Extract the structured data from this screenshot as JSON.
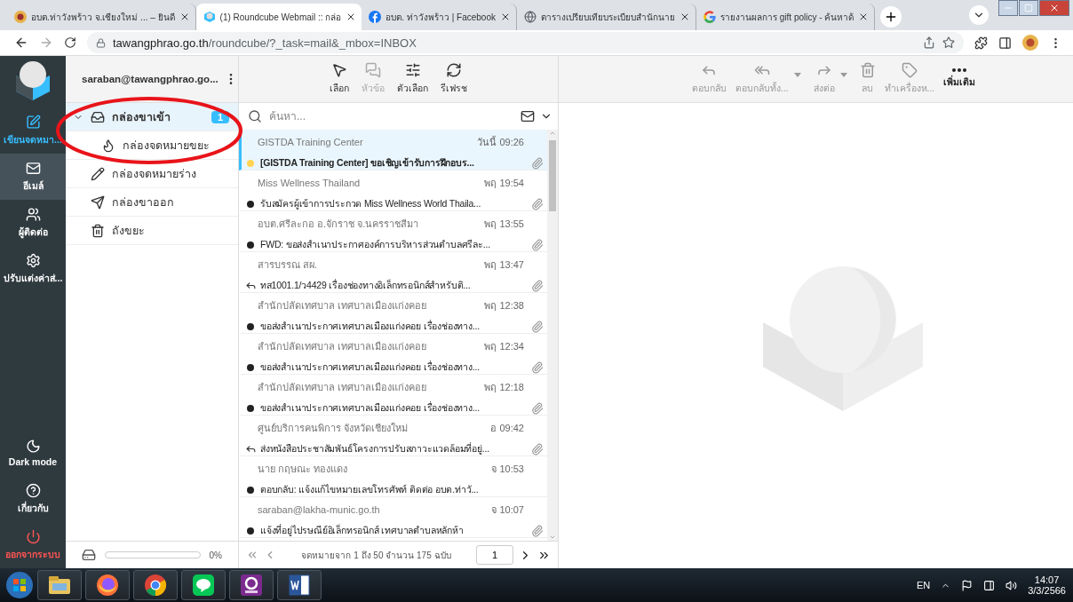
{
  "browser": {
    "tabs": [
      {
        "title": "อบต.ท่าวังพร้าว จ.เชียงใหม่ ... – ยินดี",
        "selected": false
      },
      {
        "title": "(1) Roundcube Webmail :: กล่อ",
        "selected": true
      },
      {
        "title": "อบต. ท่าวังพร้าว | Facebook",
        "selected": false
      },
      {
        "title": "ตารางเปรียบเทียบระเบียบสำนักนาย",
        "selected": false
      },
      {
        "title": "รายงานผลการ gift policy - ค้นหาด้",
        "selected": false
      }
    ],
    "url": {
      "host": "tawangphrao.go.th",
      "path": "/roundcube/?_task=mail&_mbox=INBOX"
    }
  },
  "nav": {
    "top": [
      {
        "kind": "compose",
        "label": "เขียนจดหมา...",
        "selected": false
      },
      {
        "kind": "mail",
        "label": "อีเมล์",
        "selected": true
      },
      {
        "kind": "contacts",
        "label": "ผู้ติดต่อ",
        "selected": false
      },
      {
        "kind": "settings",
        "label": "ปรับแต่งค่าส่...",
        "selected": false
      }
    ],
    "bottom": [
      {
        "kind": "dark",
        "label": "Dark mode",
        "selected": false
      },
      {
        "kind": "about",
        "label": "เกี่ยวกับ",
        "selected": false
      },
      {
        "kind": "logout",
        "label": "ออกจากระบบ",
        "selected": false
      }
    ]
  },
  "account": "saraban@tawangphrao.go...",
  "folders": [
    {
      "kind": "inbox",
      "name": "กล่องขาเข้า",
      "selected": true,
      "expanded": true,
      "unread": "1",
      "children": [
        {
          "kind": "junk",
          "name": "กล่องจดหมายขยะ",
          "selected": false
        }
      ]
    },
    {
      "kind": "drafts",
      "name": "กล่องจดหมายร่าง",
      "selected": false
    },
    {
      "kind": "sent",
      "name": "กล่องขาออก",
      "selected": false
    },
    {
      "kind": "trash",
      "name": "ถังขยะ",
      "selected": false
    }
  ],
  "quota": {
    "level": 0,
    "reading": "0%"
  },
  "list_toolbar": [
    {
      "kind": "select",
      "label": "เลือก",
      "disabled": false
    },
    {
      "kind": "threads",
      "label": "หัวข้อ",
      "disabled": true
    },
    {
      "kind": "options",
      "label": "ตัวเลือก",
      "disabled": false
    },
    {
      "kind": "refresh",
      "label": "รีเฟรช",
      "disabled": false
    }
  ],
  "search": {
    "placeholder": "ค้นหา..."
  },
  "messages": [
    {
      "sender": "GISTDA Training Center",
      "date": "วันนี้ 09:26",
      "subject": "[GISTDA Training Center] ขอเชิญเข้ารับการฝึกอบร...",
      "kind": "flagged",
      "attachment": true,
      "selected": true
    },
    {
      "sender": "Miss Wellness Thailand",
      "date": "พฤ 19:54",
      "subject": "รับสมัครผู้เข้าการประกวด Miss Wellness World Thaila...",
      "kind": "unread",
      "attachment": true,
      "selected": false
    },
    {
      "sender": "อบต.ศรีละกอ อ.จักราช จ.นครราชสีมา",
      "date": "พฤ 13:55",
      "subject": "FWD: ขอส่งสำเนาประกาศองค์การบริหารส่วนตำบลศรีละ...",
      "kind": "unread",
      "attachment": true,
      "selected": false
    },
    {
      "sender": "สารบรรณ สผ.",
      "date": "พฤ 13:47",
      "subject": "ทส1001.1/ว4429 เรื่องช่องทางอิเล็กทรอนิกส์สำหรับติ...",
      "kind": "replied",
      "attachment": true,
      "selected": false
    },
    {
      "sender": "สำนักปลัดเทศบาล เทศบาลเมืองแก่งคอย",
      "date": "พฤ 12:38",
      "subject": "ขอส่งสำเนาประกาศเทศบาลเมืองแก่งคอย เรื่องช่องทาง...",
      "kind": "unread",
      "attachment": true,
      "selected": false
    },
    {
      "sender": "สำนักปลัดเทศบาล เทศบาลเมืองแก่งคอย",
      "date": "พฤ 12:34",
      "subject": "ขอส่งสำเนาประกาศเทศบาลเมืองแก่งคอย เรื่องช่องทาง...",
      "kind": "unread",
      "attachment": true,
      "selected": false
    },
    {
      "sender": "สำนักปลัดเทศบาล เทศบาลเมืองแก่งคอย",
      "date": "พฤ 12:18",
      "subject": "ขอส่งสำเนาประกาศเทศบาลเมืองแก่งคอย เรื่องช่องทาง...",
      "kind": "unread",
      "attachment": true,
      "selected": false
    },
    {
      "sender": "ศูนย์บริการคนพิการ จังหวัดเชียงใหม่",
      "date": "อ 09:42",
      "subject": "ส่งหนังสือประชาสัมพันธ์โครงการปรับสภาวะแวดล้อมที่อยู่...",
      "kind": "replied",
      "attachment": true,
      "selected": false
    },
    {
      "sender": "นาย กฤษณะ ทองแดง",
      "date": "จ 10:53",
      "subject": "ตอบกลับ: แจ้งแก้ไขหมายเลขโทรศัพท์ ติดต่อ อบต.ท่าวั...",
      "kind": "unread",
      "attachment": false,
      "selected": false
    },
    {
      "sender": "saraban@lakha-munic.go.th",
      "date": "จ 10:07",
      "subject": "แจ้งที่อยู่ไปรษณีย์อิเล็กทรอนิกส์ เทศบาลตำบลหลักห้า",
      "kind": "unread",
      "attachment": true,
      "selected": false
    }
  ],
  "pagination": {
    "text": "จดหมายจาก 1 ถึง 50 จำนวน 175 ฉบับ",
    "page": "1"
  },
  "message_toolbar": [
    {
      "kind": "reply",
      "label": "ตอบกลับ",
      "disabled": true,
      "menu": false
    },
    {
      "kind": "reply_all",
      "label": "ตอบกลับทั้ง...",
      "disabled": true,
      "menu": true
    },
    {
      "kind": "forward",
      "label": "ส่งต่อ",
      "disabled": true,
      "menu": true
    },
    {
      "kind": "delete",
      "label": "ลบ",
      "disabled": true,
      "menu": false
    },
    {
      "kind": "mark",
      "label": "ทำเครื่องห...",
      "disabled": true,
      "menu": false
    },
    {
      "kind": "more",
      "label": "เพิ่มเติม",
      "disabled": false,
      "menu": false
    }
  ],
  "taskbar": {
    "apps": [
      {
        "kind": "explorer"
      },
      {
        "kind": "firefox"
      },
      {
        "kind": "chrome"
      },
      {
        "kind": "line"
      },
      {
        "kind": "pdf"
      },
      {
        "kind": "word"
      }
    ],
    "language": "EN",
    "time": "14:07",
    "date": "3/3/2566"
  }
}
